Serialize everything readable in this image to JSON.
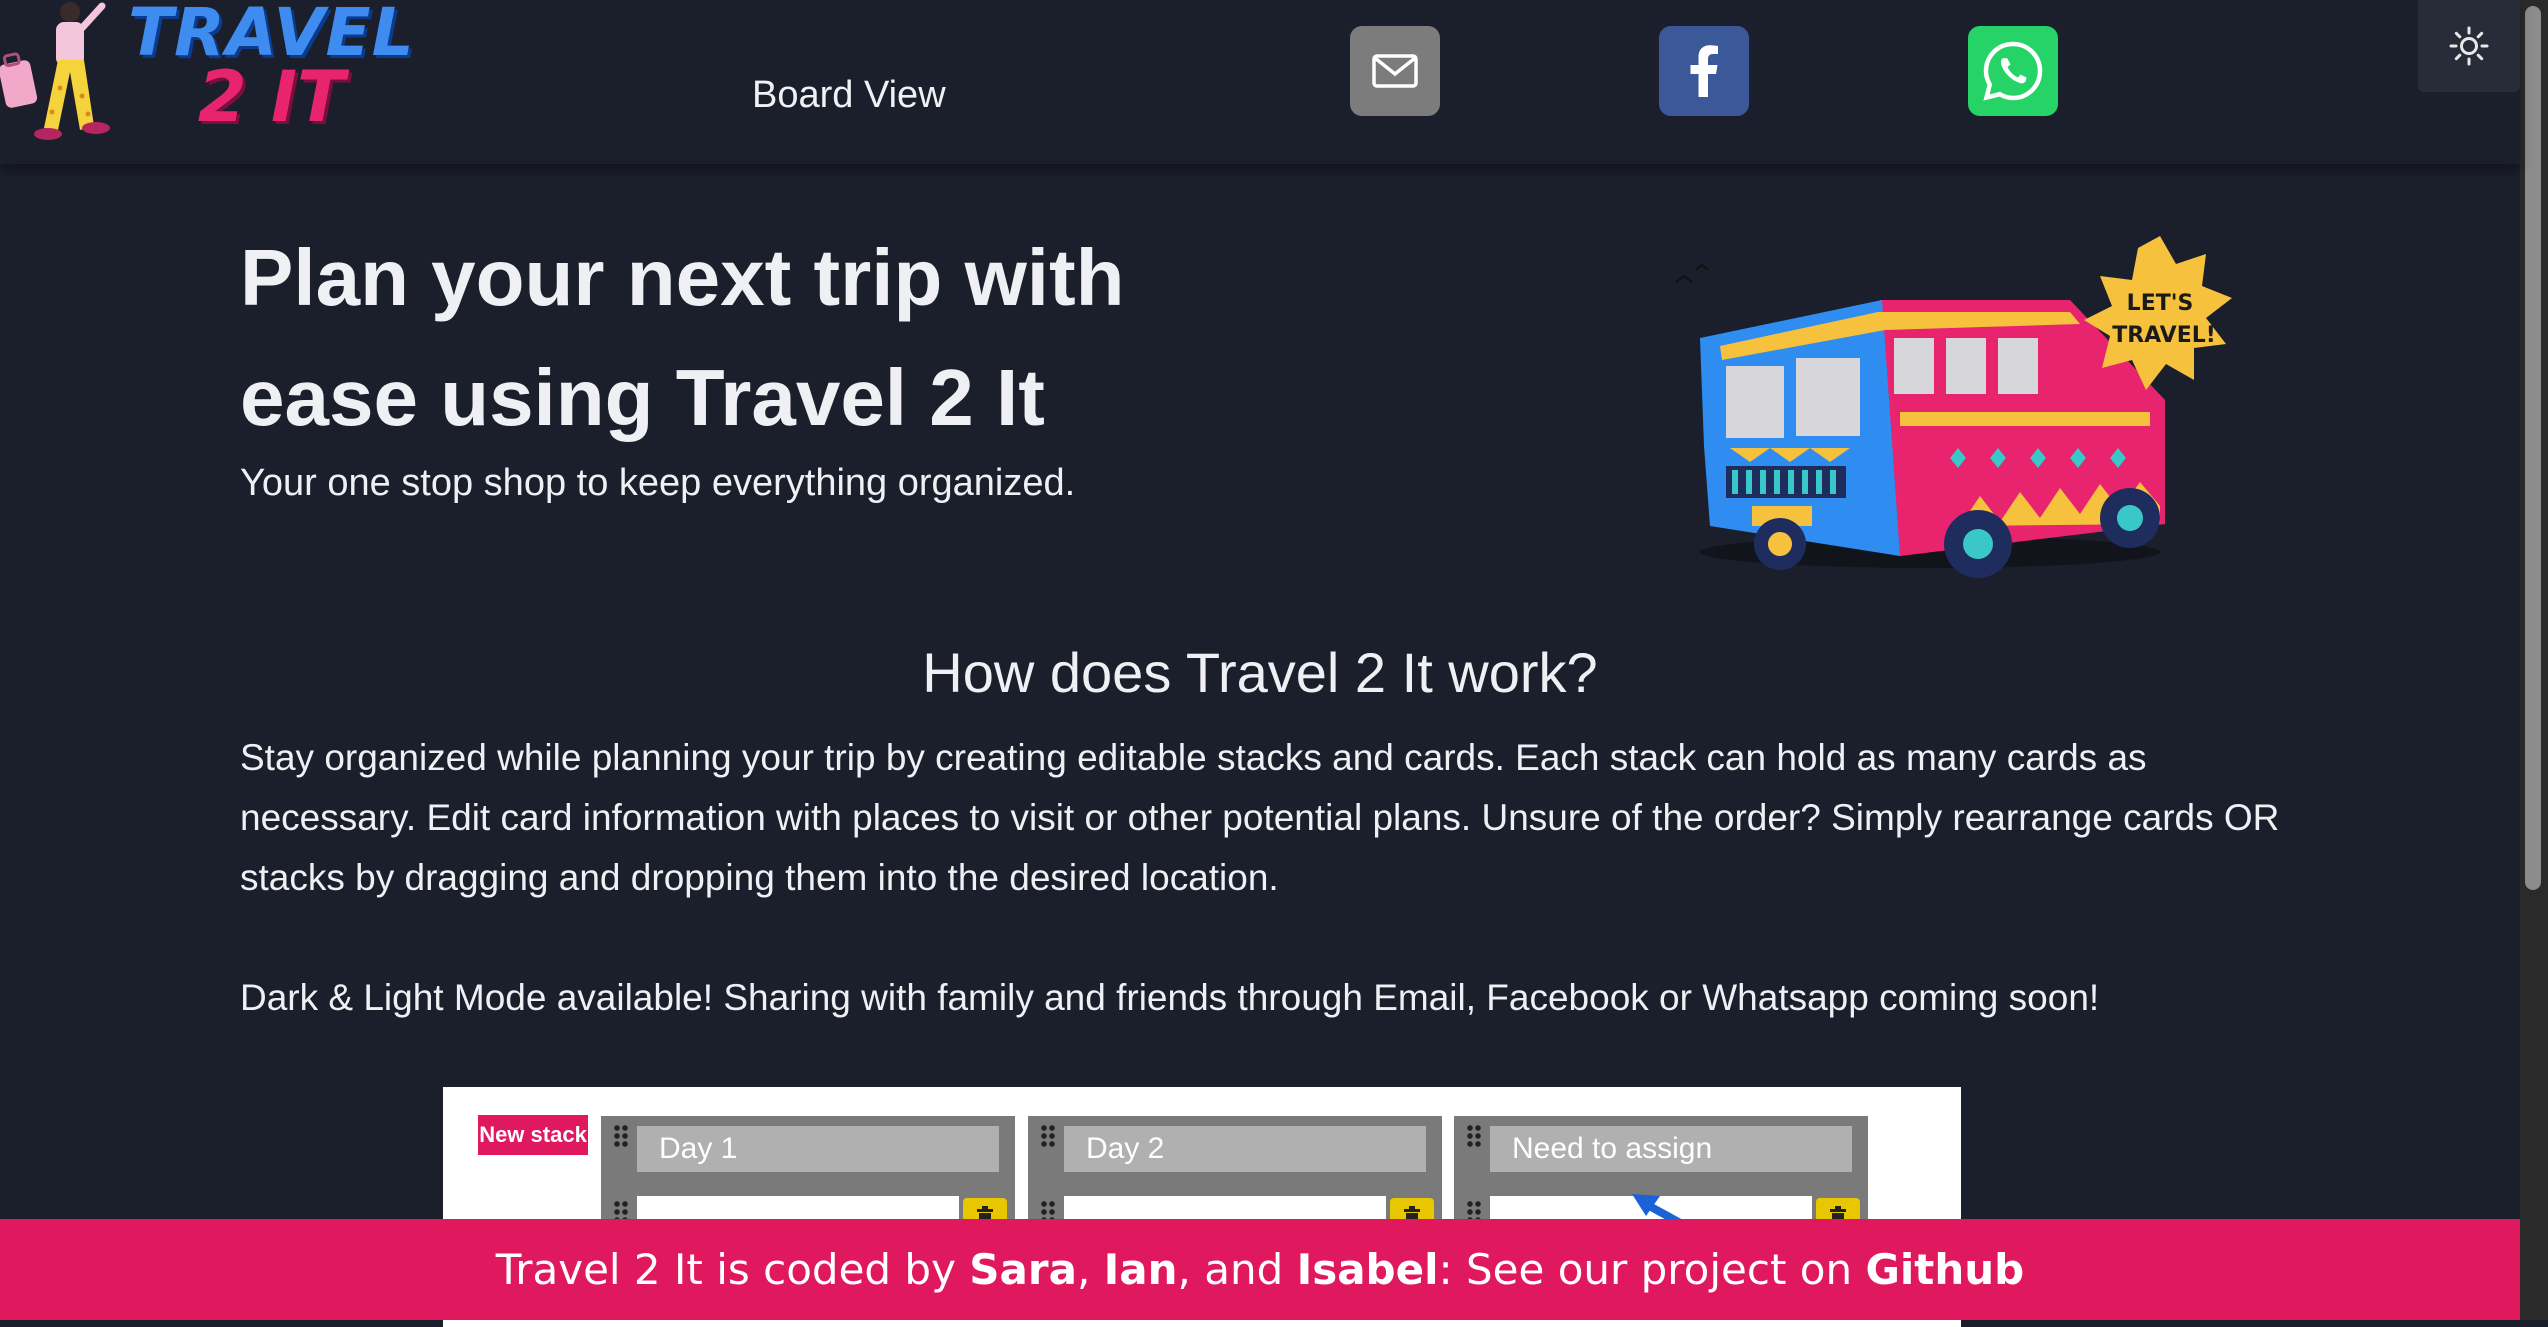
{
  "header": {
    "logo": {
      "line1": "TRAVEL",
      "line2": "2 IT"
    },
    "nav_link": "Board View",
    "share_buttons": [
      {
        "name": "email",
        "icon": "envelope-icon",
        "color": "#7c7c7c"
      },
      {
        "name": "facebook",
        "icon": "facebook-icon",
        "color": "#3b5998"
      },
      {
        "name": "whatsapp",
        "icon": "whatsapp-icon",
        "color": "#25d366"
      }
    ],
    "theme_toggle_icon": "sun-icon"
  },
  "hero": {
    "title_line1": "Plan your next trip with",
    "title_line2": "ease using Travel 2 It",
    "subtitle": "Your one stop shop to keep everything organized.",
    "illustration": {
      "badge_line1": "LET'S",
      "badge_line2": "TRAVEL!"
    }
  },
  "how": {
    "heading": "How does Travel 2 It work?",
    "body": "Stay organized while planning your trip by creating editable stacks and cards. Each stack can hold as many cards as necessary. Edit card information with places to visit or other potential plans. Unsure of the order? Simply rearrange cards OR stacks by dragging and dropping them into the desired location.",
    "note": "Dark & Light Mode available! Sharing with family and friends through Email, Facebook or Whatsapp coming soon!"
  },
  "preview": {
    "new_stack_label": "New stack",
    "stacks": [
      {
        "title": "Day 1"
      },
      {
        "title": "Day 2"
      },
      {
        "title": "Need to assign"
      }
    ]
  },
  "footer": {
    "prefix": "Travel 2 It is coded by ",
    "name1": "Sara",
    "sep1": ", ",
    "name2": "Ian",
    "sep2": ", and ",
    "name3": "Isabel",
    "middle": ": See our project on ",
    "link": "Github"
  },
  "colors": {
    "background": "#1b1f2b",
    "footer": "#e0195f",
    "logo_blue": "#3f8cf0",
    "logo_pink": "#e8246f"
  }
}
